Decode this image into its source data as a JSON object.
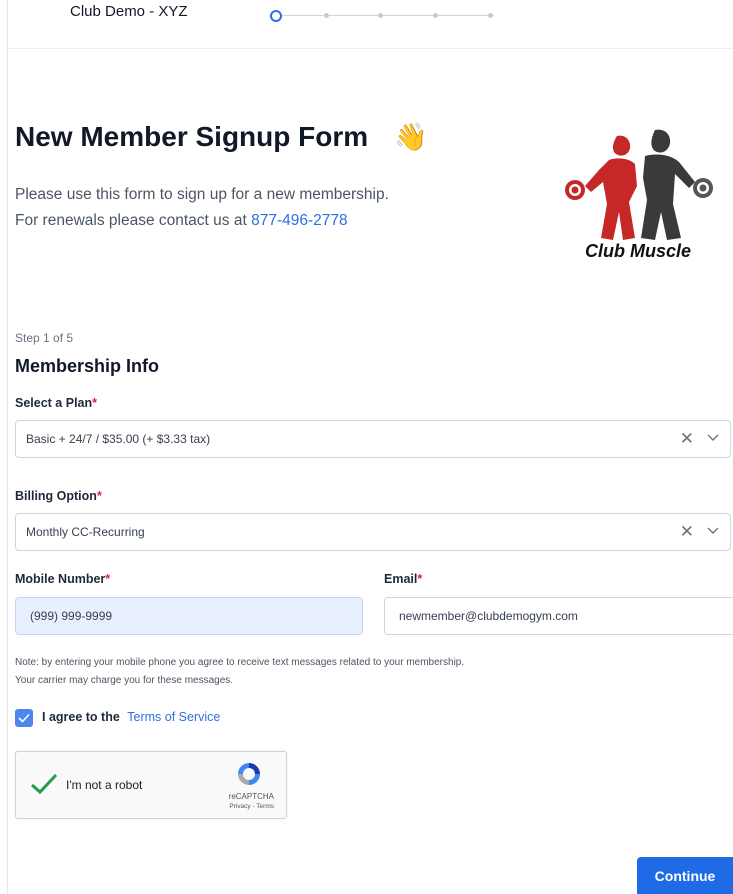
{
  "header": {
    "club_name": "Club Demo - XYZ",
    "steps_total": 5,
    "current_step": 1
  },
  "hero": {
    "title": "New Member Signup Form",
    "intro_line1": "Please use this form to sign up for a new membership.",
    "intro_line2_prefix": "For renewals please contact us at",
    "phone": "877-496-2778",
    "logo_text": "Club Muscle"
  },
  "form": {
    "step_label": "Step 1 of 5",
    "section_title": "Membership Info",
    "plan": {
      "label": "Select a Plan",
      "required_mark": "*",
      "value": "Basic + 24/7 / $35.00 (+ $3.33 tax)"
    },
    "billing": {
      "label": "Billing Option",
      "required_mark": "*",
      "value": "Monthly CC-Recurring"
    },
    "mobile": {
      "label": "Mobile Number",
      "required_mark": "*",
      "value": "(999) 999-9999"
    },
    "email": {
      "label": "Email",
      "required_mark": "*",
      "value": "newmember@clubdemogym.com"
    },
    "note_line1": "Note: by entering your mobile phone you agree to receive text messages related to your membership.",
    "note_line2": "Your carrier may charge you for these messages.",
    "agree_prefix": "I agree to the",
    "terms_link": "Terms of Service",
    "agree_checked": true
  },
  "recaptcha": {
    "label": "I'm not a robot",
    "brand": "reCAPTCHA",
    "links": "Privacy - Terms"
  },
  "actions": {
    "continue_label": "Continue"
  },
  "colors": {
    "primary": "#1f6be6",
    "link": "#2f6fe0",
    "required": "#e11d48",
    "autofill": "#e8f0fe"
  }
}
